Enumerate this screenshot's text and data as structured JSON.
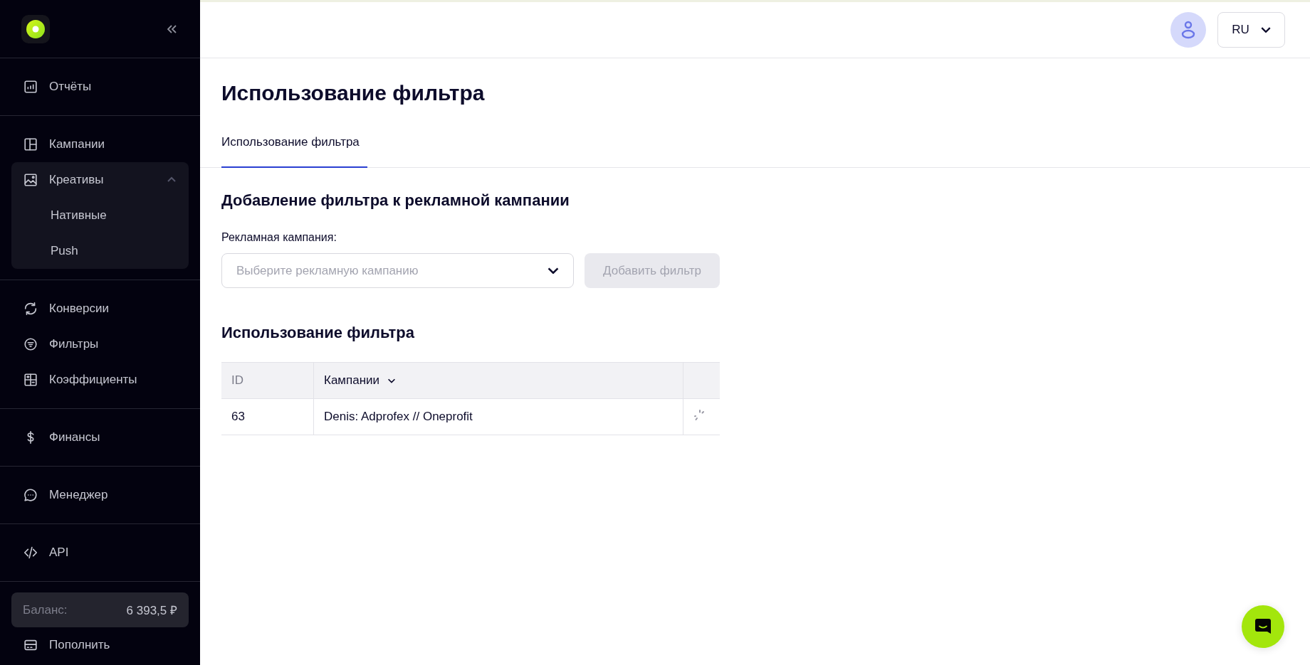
{
  "sidebar": {
    "groups": [
      [
        {
          "label": "Отчёты"
        }
      ],
      [
        {
          "label": "Кампании"
        },
        {
          "label": "Креативы",
          "expanded": true,
          "children": [
            {
              "label": "Нативные"
            },
            {
              "label": "Push"
            }
          ]
        }
      ],
      [
        {
          "label": "Конверсии"
        },
        {
          "label": "Фильтры"
        },
        {
          "label": "Коэффициенты"
        }
      ],
      [
        {
          "label": "Финансы"
        }
      ],
      [
        {
          "label": "Менеджер"
        }
      ],
      [
        {
          "label": "API"
        }
      ]
    ],
    "balance": {
      "label": "Баланс:",
      "value": "6 393,5 ₽"
    },
    "top_up": "Пополнить"
  },
  "header": {
    "language": "RU"
  },
  "page_title": "Использование фильтра",
  "tabs": [
    {
      "label": "Использование фильтра",
      "selected": true
    }
  ],
  "add_section": {
    "title": "Добавление фильтра к рекламной кампании",
    "field_label": "Рекламная кампания:",
    "placeholder": "Выберите рекламную кампанию",
    "button": "Добавить фильтр",
    "button_disabled": true
  },
  "usage_section": {
    "title": "Использование фильтра"
  },
  "table": {
    "columns": [
      "ID",
      "Кампании"
    ],
    "rows": [
      {
        "id": "63",
        "campaign": "Denis: Adprofex // Oneprofit",
        "loading": true
      }
    ]
  }
}
